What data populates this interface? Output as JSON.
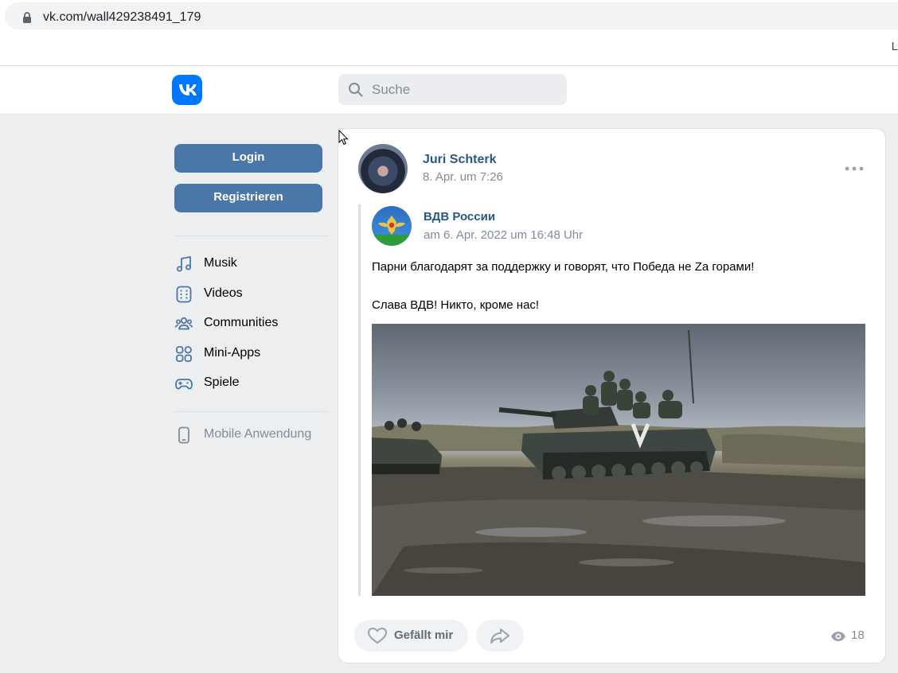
{
  "browser": {
    "url": "vk.com/wall429238491_179",
    "bookmark_edge_text": "L"
  },
  "header": {
    "logo_icon": "vk-logo-icon",
    "search_placeholder": "Suche"
  },
  "sidebar": {
    "login_label": "Login",
    "register_label": "Registrieren",
    "items": [
      {
        "label": "Musik",
        "icon": "music-note-icon"
      },
      {
        "label": "Videos",
        "icon": "video-film-icon"
      },
      {
        "label": "Communities",
        "icon": "users-icon"
      },
      {
        "label": "Mini-Apps",
        "icon": "apps-grid-icon"
      },
      {
        "label": "Spiele",
        "icon": "gamepad-icon"
      }
    ],
    "mobile_label": "Mobile Anwendung"
  },
  "post": {
    "author": "Juri Schterk",
    "date": "8. Apr. um 7:26",
    "repost": {
      "author": "ВДВ России",
      "date": "am 6. Apr. 2022 um 16:48 Uhr",
      "text_line1": "Парни благодарят за поддержку и говорят, что Победа не Zа горами!",
      "text_line2": "Слава ВДВ! Никто, кроме нас!"
    },
    "like_label": "Gefällt mir",
    "views_count": "18"
  },
  "colors": {
    "vk_blue": "#0077ff",
    "button_blue": "#4a76a8",
    "link_blue": "#2a5885",
    "secondary_text": "#818c99",
    "page_bg": "#edeef0"
  }
}
